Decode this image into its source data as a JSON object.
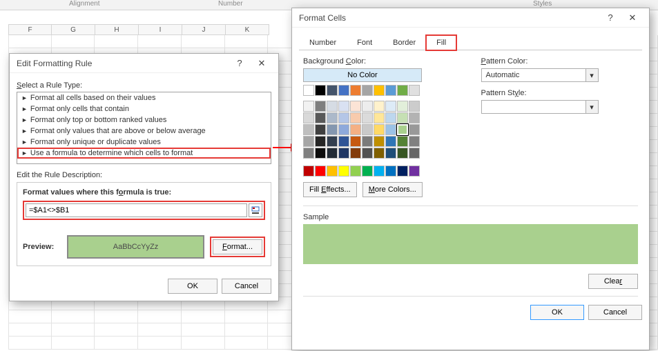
{
  "ribbon": {
    "groups": [
      "Alignment",
      "Number",
      "Styles"
    ],
    "columns": [
      "F",
      "G",
      "H",
      "I",
      "J",
      "K"
    ]
  },
  "edit_rule_dialog": {
    "title": "Edit Formatting Rule",
    "select_rule_label_pre": "S",
    "select_rule_label_rest": "elect a Rule Type:",
    "rule_types": [
      "Format all cells based on their values",
      "Format only cells that contain",
      "Format only top or bottom ranked values",
      "Format only values that are above or below average",
      "Format only unique or duplicate values",
      "Use a formula to determine which cells to format"
    ],
    "edit_desc_label": "Edit the Rule Description:",
    "formula_label_pre": "Format values where this f",
    "formula_label_und": "o",
    "formula_label_post": "rmula is true:",
    "formula_value": "=$A1<>$B1",
    "preview_label": "Preview:",
    "preview_text": "AaBbCcYyZz",
    "format_btn": "Format...",
    "ok_btn": "OK",
    "cancel_btn": "Cancel"
  },
  "format_cells_dialog": {
    "title": "Format Cells",
    "tabs": [
      "Number",
      "Font",
      "Border",
      "Fill"
    ],
    "active_tab": "Fill",
    "bg_label_pre": "Background ",
    "bg_label_und": "C",
    "bg_label_post": "olor:",
    "no_color": "No Color",
    "fill_effects_btn": "Fill Effects...",
    "more_colors_btn": "More Colors...",
    "pattern_color_label_und": "P",
    "pattern_color_label_rest": "attern Color:",
    "pattern_color_value": "Automatic",
    "pattern_style_label": "Pattern St",
    "pattern_style_und": "y",
    "pattern_style_rest": "le:",
    "sample_label": "Sample",
    "clear_btn": "Clear",
    "ok_btn": "OK",
    "cancel_btn": "Cancel",
    "theme_colors_row0": [
      "#ffffff",
      "#000000",
      "#44546a",
      "#4472c4",
      "#ed7d31",
      "#a5a5a5",
      "#ffc000",
      "#5b9bd5",
      "#70ad47",
      "#e0e0e0"
    ],
    "color_rows": [
      [
        "#f2f2f2",
        "#7f7f7f",
        "#d6dce4",
        "#d9e1f2",
        "#fce4d6",
        "#ededed",
        "#fff2cc",
        "#ddebf7",
        "#e2efda",
        "#cccccc"
      ],
      [
        "#d9d9d9",
        "#595959",
        "#acb9ca",
        "#b4c6e7",
        "#f8cbad",
        "#dbdbdb",
        "#ffe699",
        "#bdd7ee",
        "#c6e0b4",
        "#b3b3b3"
      ],
      [
        "#bfbfbf",
        "#404040",
        "#8497b0",
        "#8ea9db",
        "#f4b084",
        "#c9c9c9",
        "#ffd966",
        "#9bc2e6",
        "#a9d08e",
        "#999999"
      ],
      [
        "#a6a6a6",
        "#262626",
        "#333f4f",
        "#305496",
        "#c65911",
        "#7b7b7b",
        "#bf8f00",
        "#2f75b5",
        "#548235",
        "#808080"
      ],
      [
        "#808080",
        "#0d0d0d",
        "#222b35",
        "#203764",
        "#833c0c",
        "#525252",
        "#806000",
        "#1f4e78",
        "#375623",
        "#666666"
      ]
    ],
    "standard_colors": [
      "#c00000",
      "#ff0000",
      "#ffc000",
      "#ffff00",
      "#92d050",
      "#00b050",
      "#00b0f0",
      "#0070c0",
      "#002060",
      "#7030a0"
    ],
    "selected_color": "#a9d08e"
  }
}
